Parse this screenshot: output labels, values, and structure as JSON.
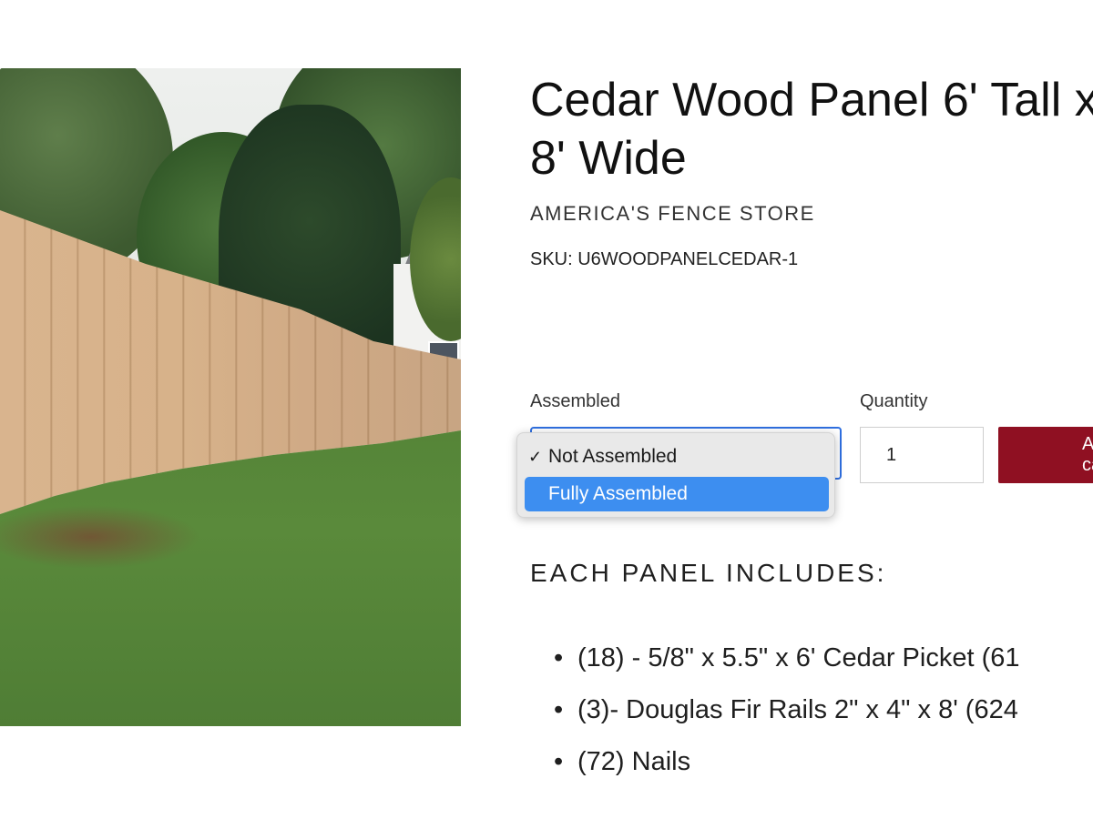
{
  "product": {
    "title": "Cedar Wood Panel 6' Tall x 8' Wide",
    "vendor": "AMERICA'S FENCE STORE",
    "sku": "SKU: U6WOODPANELCEDAR-1",
    "image_icon": "product-photo-fence"
  },
  "options": {
    "assembled_label": "Assembled",
    "selected_value": "Not Assembled",
    "items": [
      {
        "label": "Not Assembled",
        "checked": true,
        "highlighted": false
      },
      {
        "label": "Fully Assembled",
        "checked": false,
        "highlighted": true
      }
    ],
    "check_glyph": "✓"
  },
  "quantity": {
    "label": "Quantity",
    "value": "1"
  },
  "cart": {
    "add_label": "Add to cart"
  },
  "includes": {
    "heading": "EACH PANEL INCLUDES:",
    "items": [
      "(18) - 5/8\" x 5.5\" x 6' Cedar Picket (61",
      "(3)- Douglas Fir Rails 2\" x 4\" x 8' (624",
      "(72) Nails"
    ],
    "bullet": "•"
  },
  "colors": {
    "accent_select_border": "#2f6fe0",
    "highlight": "#3d8ef0",
    "add_button": "#8f1022"
  }
}
